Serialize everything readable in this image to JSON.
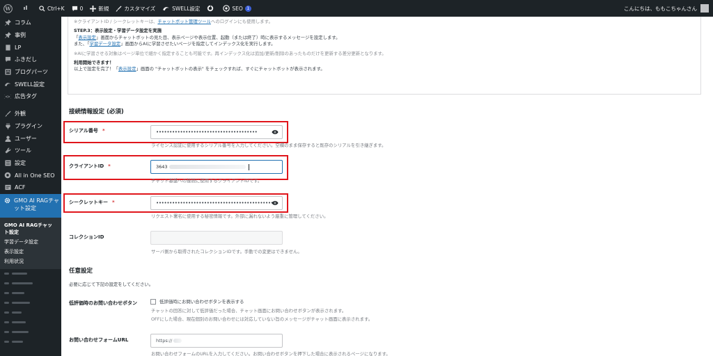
{
  "adminbar": {
    "ctrlk": "Ctrl+K",
    "comments": "0",
    "new": "新規",
    "customize": "カスタマイズ",
    "swell": "SWELL設定",
    "seo": "SEO",
    "seo_count": "1",
    "greeting": "こんにちは、ももこちゃんさん"
  },
  "sidebar": {
    "items": [
      {
        "label": "コラム",
        "icon": "pin-icon"
      },
      {
        "label": "事例",
        "icon": "pin-icon"
      },
      {
        "label": "LP",
        "icon": "page-icon"
      },
      {
        "label": "ふきだし",
        "icon": "speech-bubble-icon"
      },
      {
        "label": "ブログパーツ",
        "icon": "grid-icon"
      },
      {
        "label": "SWELL設定",
        "icon": "swell-icon"
      },
      {
        "label": "広告タグ",
        "icon": "code-icon"
      },
      {
        "label": "外観",
        "icon": "brush-icon"
      },
      {
        "label": "プラグイン",
        "icon": "plug-icon"
      },
      {
        "label": "ユーザー",
        "icon": "user-icon"
      },
      {
        "label": "ツール",
        "icon": "wrench-icon"
      },
      {
        "label": "設定",
        "icon": "settings-icon"
      },
      {
        "label": "All in One SEO",
        "icon": "aioseo-icon"
      },
      {
        "label": "ACF",
        "icon": "acf-icon"
      }
    ],
    "active": "GMO AI RAGチャット設定",
    "submenu": [
      "GMO AI RAGチャット設定",
      "学習データ設定",
      "表示設定",
      "利用状況"
    ]
  },
  "notice": {
    "line1": "※クライアントID / シークレットキーは、",
    "line1_link": "チャットボット管理ツール",
    "line1_end": "へのログインにも使用します。",
    "step3_title": "STEP.3：表示設定・学習データ設定を実施",
    "step3_a_pre": "「",
    "step3_a_link": "表示設定",
    "step3_a_post": "」画面からチャットボットの見た目、表示ページや表示位置、起動（または終了）時に表示するメッセージを設定します。",
    "step3_b_pre": "また、「",
    "step3_b_link": "学習データ設定",
    "step3_b_post": "」画面からAIに学習させたいページを指定してインデックス化を実行します。",
    "note": "※AIに学習させる対象はページ単位で細かく指定することも可能です。再インデックス化は追加/更新/削除のあったものだけを更新する差分更新となります。",
    "start_title": "利用開始できます！",
    "start_pre": "以上で設定を完了！「",
    "start_link": "表示設定",
    "start_post": "」画面の \"チャットボットの表示\" をチェックすれば、すぐにチャットボットが表示されます。"
  },
  "connection": {
    "heading": "接続情報設定 (必須)",
    "serial_label": "シリアル番号",
    "serial_value": "••••••••••••••••••••••••••••••••••••••",
    "serial_desc": "ライセンス認証に使用するシリアル番号を入力してください。空欄のまま保存すると既存のシリアルを引き継ぎます。",
    "client_label": "クライアントID",
    "client_value": "3643",
    "client_desc": "チャット基盤への接続に使用するクライアントIDです。",
    "secret_label": "シークレットキー",
    "secret_value": "••••••••••••••••••••••••••••••••••••••••••••",
    "secret_desc": "リクエスト署名に使用する秘密情報です。外部に漏れないよう厳重に管理してください。",
    "collection_label": "コレクションID",
    "collection_desc": "サーバ側から取得されたコレクションIDです。手動での変更はできません。",
    "required_mark": "*"
  },
  "optional": {
    "heading": "任意設定",
    "intro": "必要に応じて下記の設定をしてください。",
    "lowrating_label": "低評価時のお問い合わせボタン",
    "lowrating_cb": "低評価時にお問い合わせボタンを表示する",
    "lowrating_desc1": "チャットの回答に対して低評価だった場合、チャット画面にお問い合わせボタンが表示されます。",
    "lowrating_desc2": "OFFにした場合、現在個別のお問い合わせには対応していない旨のメッセージがチャット画面に表示されます。",
    "form_label": "お問い合わせフォームURL",
    "form_value": "https://",
    "form_desc": "お問い合わせフォームのURLを入力してください。お問い合わせボタンを押下した場合に表示されるページになります。"
  },
  "colors": {
    "highlight": "#e0151b",
    "accent": "#2271b1",
    "sidebar": "#1d2327"
  }
}
